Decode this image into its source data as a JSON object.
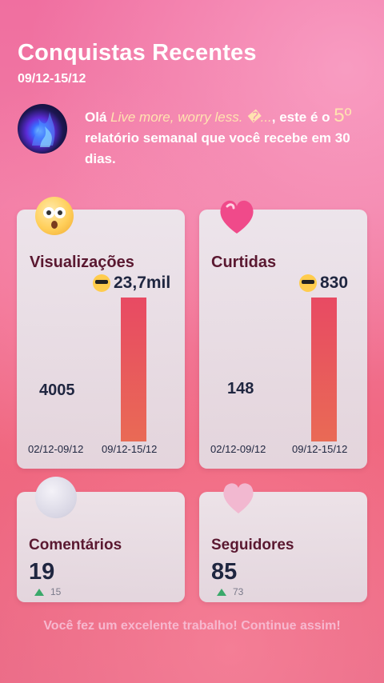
{
  "header": {
    "title": "Conquistas Recentes",
    "date_range": "09/12-15/12"
  },
  "greeting": {
    "prefix": "Olá ",
    "username": "Live more, worry less. �...",
    "middle": ", este é o ",
    "ordinal": "5º",
    "suffix": " relatório semanal que você recebe em 30 dias."
  },
  "cards": {
    "views": {
      "label": "Visualizações",
      "current_value": "23,7mil",
      "previous_value": "4005",
      "previous_period": "02/12-09/12",
      "current_period": "09/12-15/12",
      "emoji_icon": "astonished-face-icon"
    },
    "likes": {
      "label": "Curtidas",
      "current_value": "830",
      "previous_value": "148",
      "previous_period": "02/12-09/12",
      "current_period": "09/12-15/12",
      "emoji_icon": "heart-icon"
    },
    "comments": {
      "label": "Comentários",
      "value": "19",
      "delta": "15",
      "emoji_icon": "speech-bubble-icon"
    },
    "followers": {
      "label": "Seguidores",
      "value": "85",
      "delta": "73",
      "emoji_icon": "heart-bow-icon"
    }
  },
  "footer": {
    "message": "Você fez um excelente trabalho! Continue assim!"
  },
  "colors": {
    "accent_bar": "#e84a63",
    "delta_up": "#3aa86a",
    "card_title": "#5a1830"
  }
}
